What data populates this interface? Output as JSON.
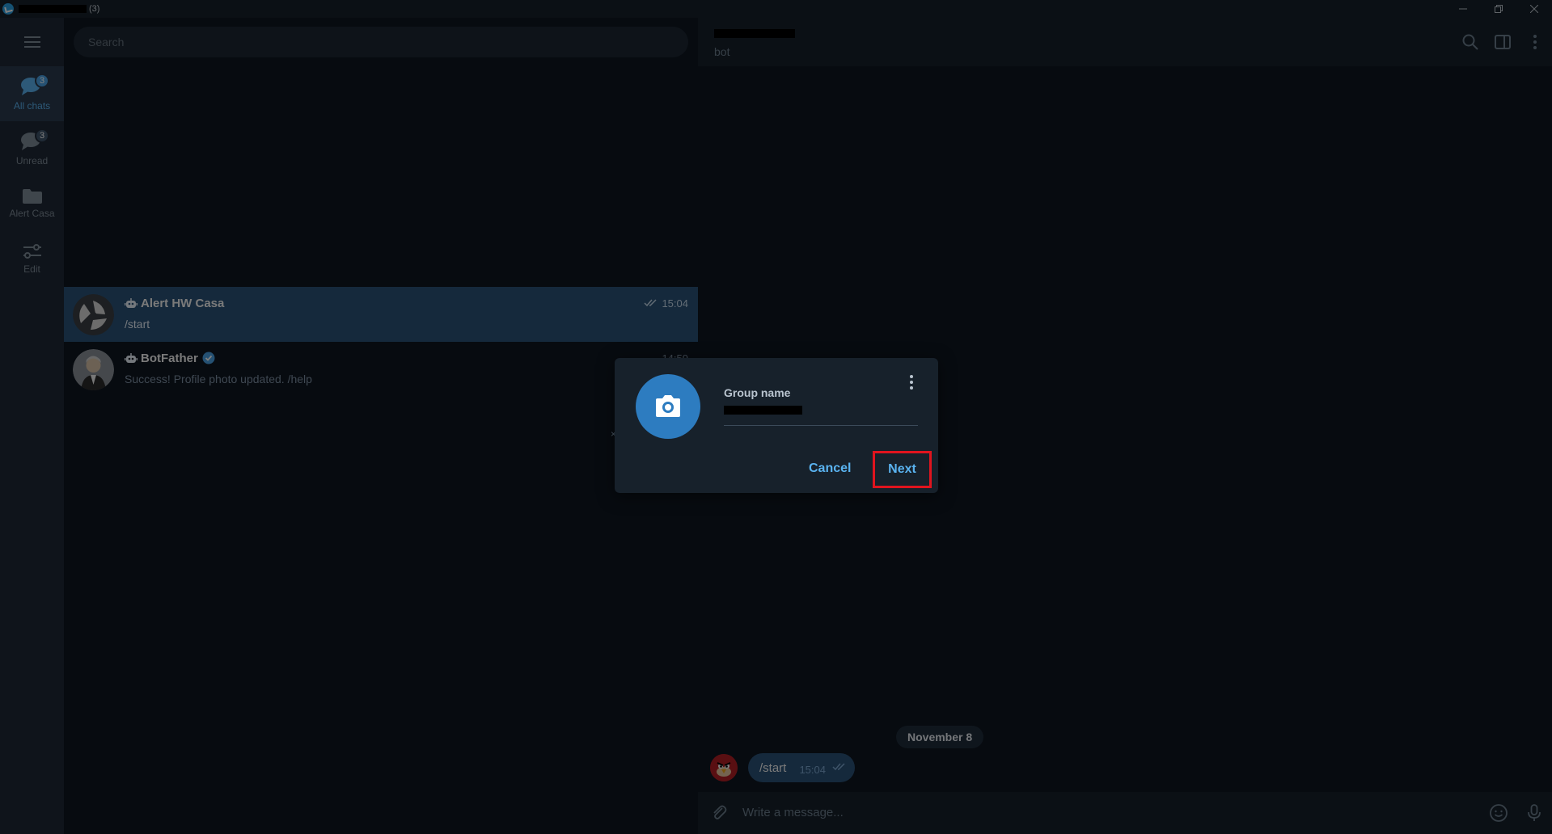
{
  "titlebar": {
    "count": "(3)"
  },
  "folders": [
    {
      "label": "All chats",
      "badge": "3",
      "icon": "chat-bubbles-icon"
    },
    {
      "label": "Unread",
      "badge": "3",
      "icon": "chat-bubbles-icon"
    },
    {
      "label": "Alert Casa",
      "icon": "folder-icon"
    },
    {
      "label": "Edit",
      "icon": "sliders-icon"
    }
  ],
  "search": {
    "placeholder": "Search"
  },
  "chats": [
    {
      "name": "Alert HW Casa",
      "message": "/start",
      "time": "15:04"
    },
    {
      "name": "BotFather",
      "message": "Success! Profile photo updated. /help",
      "time": "14:59"
    }
  ],
  "chat_header": {
    "status": "bot"
  },
  "conversation": {
    "date": "November 8",
    "message": "/start",
    "time": "15:04"
  },
  "composer": {
    "placeholder": "Write a message..."
  },
  "dialog": {
    "field_label": "Group name",
    "cancel": "Cancel",
    "next": "Next"
  },
  "colors": {
    "accent": "#5ab3f0",
    "highlight": "#e0141e",
    "selected_row": "#2b5278",
    "photo_button": "#2d7cc0"
  }
}
